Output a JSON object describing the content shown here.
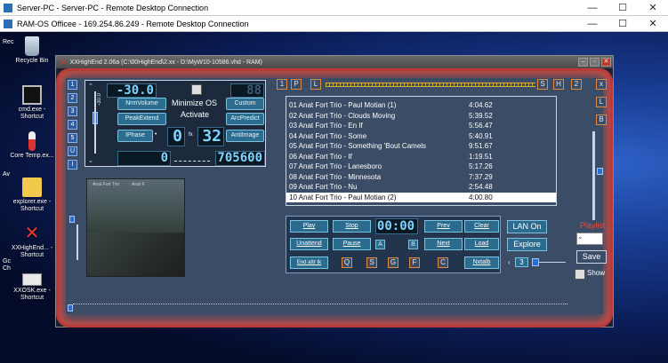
{
  "rdp_outer": {
    "title": "Server-PC - Server-PC - Remote Desktop Connection"
  },
  "rdp_inner": {
    "title": "RAM-OS Officee - 169.254.86.249 - Remote Desktop Connection"
  },
  "desktop_icons": [
    {
      "label": "Recycle Bin"
    },
    {
      "label": "cmd.exe - Shortcut"
    },
    {
      "label": "Core Temp.ex..."
    },
    {
      "label": "explorer.exe - Shortcut"
    },
    {
      "label": "XXHighEnd... - Shortcut"
    },
    {
      "label": "XXOSK.exe - Shortcut"
    }
  ],
  "desktop_partial": [
    "Rec",
    "Av",
    "Gc",
    "Ch"
  ],
  "app": {
    "title": "XXHighEnd 2.06a (C:\\00HighEnd\\2.xx - D:\\MyW10-10586.vhd - RAM)",
    "side_buttons": [
      "1",
      "2",
      "3",
      "4",
      "5",
      "U",
      "I"
    ],
    "volume_label": "-30.0",
    "display_top": "-30.0",
    "display_top_right": "88",
    "minimize_os": "Minimize OS",
    "activate": "Activate",
    "pills": {
      "nrm_volume": "NrmVolume",
      "custom": "Custom",
      "peak_extend": "PeakExtend",
      "arc_predict": "ArcPredict",
      "iphase": "IPhase",
      "antiimage": "AntiImage",
      "fx": "fx"
    },
    "display_mid_a": "0",
    "display_mid_b": "32",
    "display_bottom_right": "705600",
    "display_bottom_left": "0",
    "album_caption_left": "Anat Fort Trio",
    "album_caption_right": "Anat F",
    "left_tabs": {
      "p": "P",
      "l": "L",
      "s": "S",
      "h": "H",
      "one": "1",
      "two": "2"
    },
    "right_side": {
      "x": "x",
      "l": "L",
      "b": "B"
    },
    "playlist": [
      {
        "title": "01 Anat Fort Trio - Paul Motian (1)",
        "duration": "4:04.62"
      },
      {
        "title": "02 Anat Fort Trio - Clouds Moving",
        "duration": "5:39.52"
      },
      {
        "title": "03 Anat Fort Trio - En If",
        "duration": "5:56.47"
      },
      {
        "title": "04 Anat Fort Trio - Some",
        "duration": "5:40.91"
      },
      {
        "title": "05 Anat Fort Trio - Something 'Bout Camels",
        "duration": "9:51.67"
      },
      {
        "title": "06 Anat Fort Trio - If",
        "duration": "1:19.51"
      },
      {
        "title": "07 Anat Fort Trio - Lanesboro",
        "duration": "5:17.26"
      },
      {
        "title": "08 Anat Fort Trio - Minnesota",
        "duration": "7:37.29"
      },
      {
        "title": "09 Anat Fort Trio - Nu",
        "duration": "2:54.48"
      },
      {
        "title": "10 Anat Fort Trio - Paul Motian (2)",
        "duration": "4:00.80"
      }
    ],
    "transport": {
      "play": "Play",
      "stop": "Stop",
      "time": "00:00",
      "prev": "Prev",
      "clear": "Clear",
      "unattend": "Unattend",
      "pause": "Pause",
      "next": "Next",
      "load": "Load",
      "end_attr": "End attr tk",
      "nxtalb": "Nxtalb",
      "a": "A",
      "b": "B",
      "q": "Q",
      "s": "S",
      "g": "G",
      "f": "F",
      "c": "C"
    },
    "lan_on": "LAN On",
    "explore": "Explore",
    "playlist_label": "Playlist",
    "save": "Save",
    "shuffle_count": "3",
    "show": "Show"
  }
}
